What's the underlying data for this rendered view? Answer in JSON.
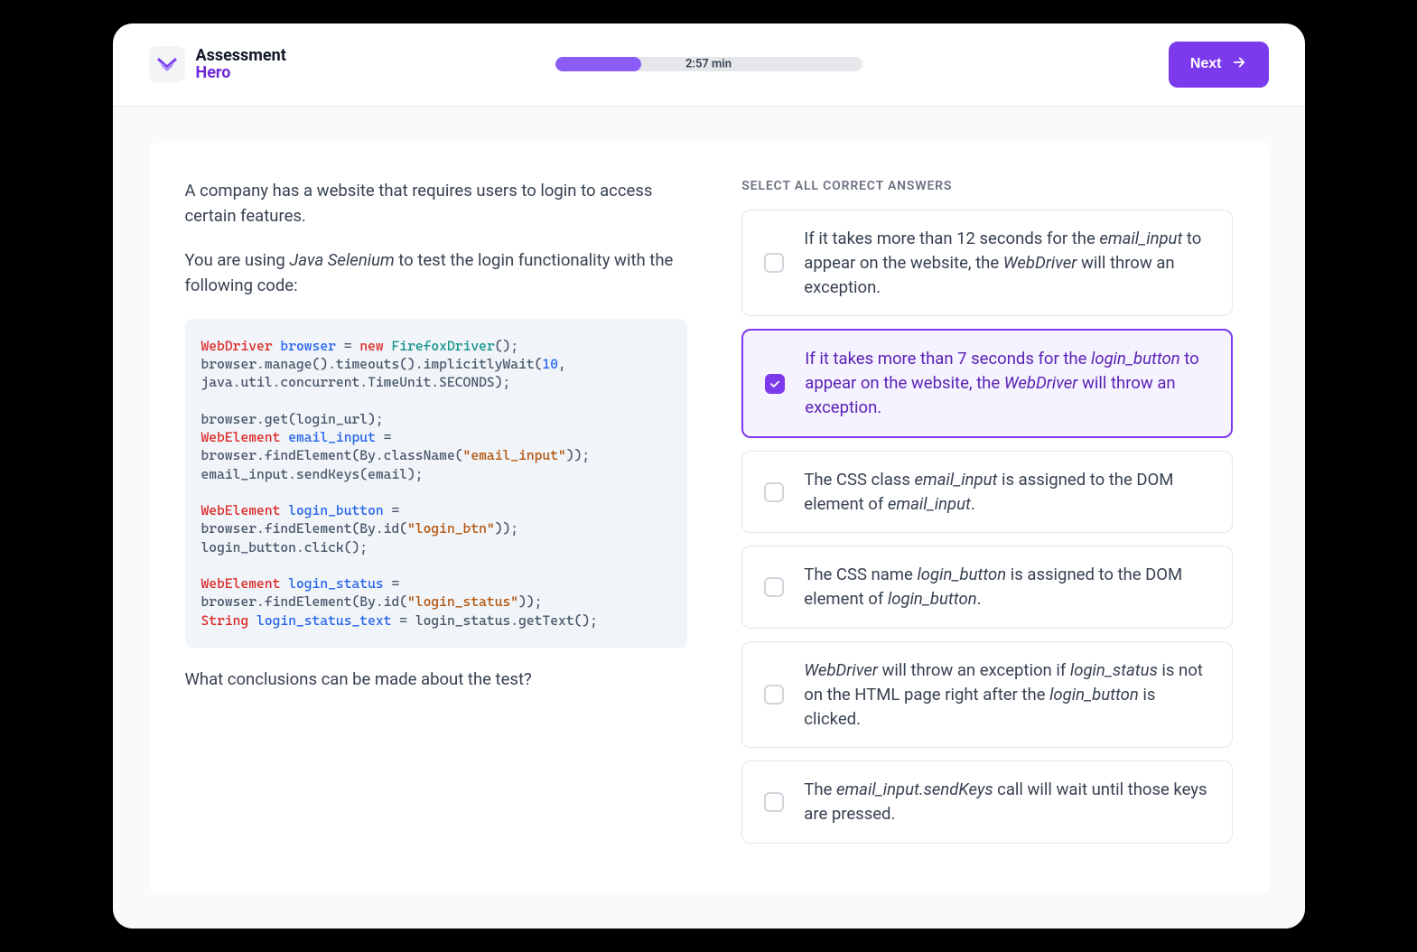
{
  "brand": {
    "line1": "Assessment",
    "line2": "Hero"
  },
  "timer": {
    "label": "2:57 min",
    "progress_pct": 28
  },
  "next_button": {
    "label": "Next"
  },
  "question": {
    "p1_html": "A company has a website that requires users to login to access certain features.",
    "p2_html": "You are using <em>Java Selenium</em> to test the login functionality with the following code:",
    "p3_html": "What conclusions can be made about the test?",
    "code_html": "<span class=\"c-type\">WebDriver</span> <span class=\"c-var\">browser</span> = <span class=\"c-kw\">new</span> <span class=\"c-cls\">FirefoxDriver</span>();\nbrowser.manage().timeouts().implicitlyWait(<span class=\"c-num\">10</span>,\njava.util.concurrent.TimeUnit.SECONDS);\n\nbrowser.get(login_url);\n<span class=\"c-type\">WebElement</span> <span class=\"c-var\">email_input</span> =\nbrowser.findElement(By.className(<span class=\"c-str\">\"email_input\"</span>));\nemail_input.sendKeys(email);\n\n<span class=\"c-type\">WebElement</span> <span class=\"c-var\">login_button</span> =\nbrowser.findElement(By.id(<span class=\"c-str\">\"login_btn\"</span>));\nlogin_button.click();\n\n<span class=\"c-type\">WebElement</span> <span class=\"c-var\">login_status</span> =\nbrowser.findElement(By.id(<span class=\"c-str\">\"login_status\"</span>));\n<span class=\"c-type\">String</span> <span class=\"c-var\">login_status_text</span> = login_status.getText();"
  },
  "answers": {
    "heading": "SELECT ALL CORRECT ANSWERS",
    "options": [
      {
        "selected": false,
        "html": "If it takes more than 12 seconds for the <em>email_input</em> to appear on the website, the <em>WebDriver</em> will throw an exception."
      },
      {
        "selected": true,
        "html": "If it takes more than 7 seconds for the <em>login_button</em> to appear on the website, the <em>WebDriver</em> will throw an exception."
      },
      {
        "selected": false,
        "html": "The CSS class <em>email_input</em> is assigned to the DOM element of <em>email_input</em>."
      },
      {
        "selected": false,
        "html": "The CSS name <em>login_button</em> is assigned to the DOM element of <em>login_button</em>."
      },
      {
        "selected": false,
        "html": "<em>WebDriver</em> will throw an exception if <em>login_status</em> is not on the HTML page right after the <em>login_button</em> is clicked."
      },
      {
        "selected": false,
        "html": "The <em>email_input.sendKeys</em> call will wait until those keys are pressed."
      }
    ]
  }
}
